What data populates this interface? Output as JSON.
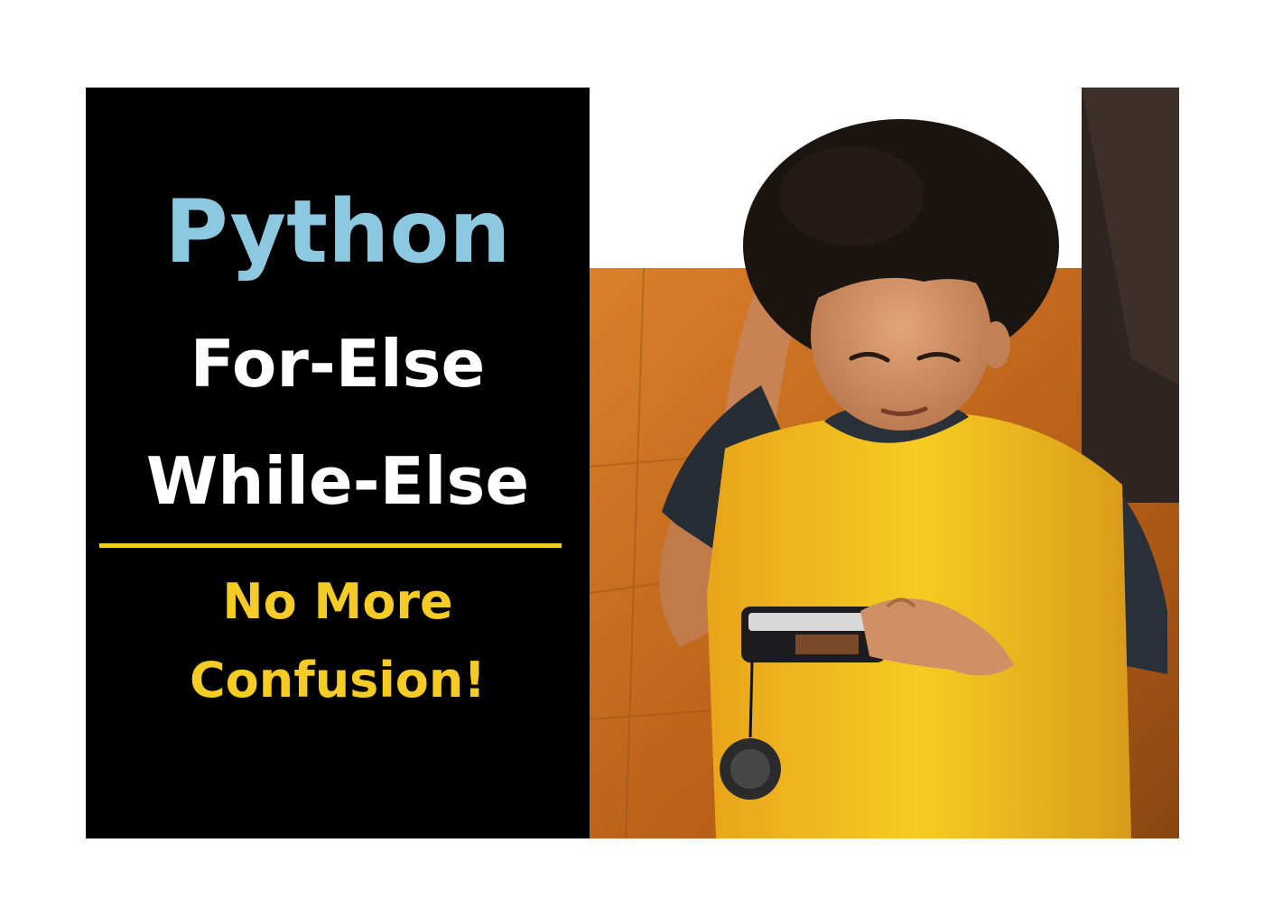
{
  "headline": {
    "language": "Python",
    "line1": "For-Else",
    "line2": "While-Else"
  },
  "subheadline": {
    "line1": "No More",
    "line2": "Confusion!"
  },
  "colors": {
    "panel_background": "#000000",
    "python_text": "#8cc8e0",
    "headline_text": "#ffffff",
    "accent_yellow": "#f5cc25",
    "photo_background": "#c46a1c"
  },
  "photo": {
    "subject": "child scratching head while looking at a phone"
  }
}
